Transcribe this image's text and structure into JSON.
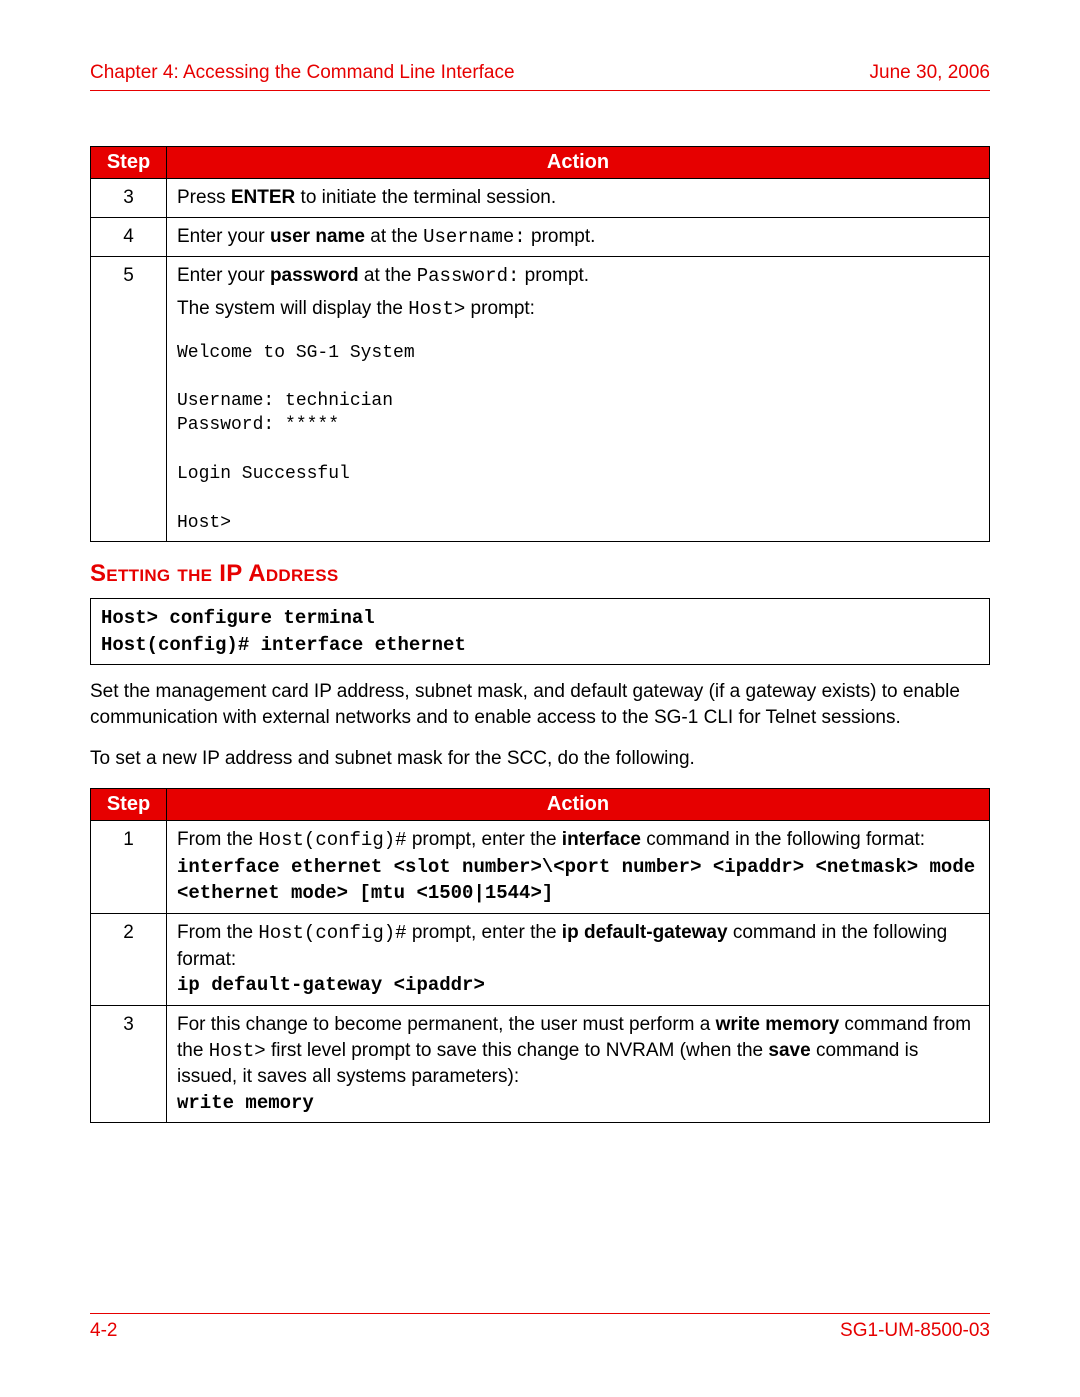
{
  "header": {
    "chapter": "Chapter 4: Accessing the Command Line Interface",
    "date": "June 30, 2006"
  },
  "table1": {
    "head_step": "Step",
    "head_action": "Action",
    "rows": {
      "r3": {
        "num": "3",
        "t1": "Press ",
        "b1": "ENTER",
        "t2": " to initiate the terminal session."
      },
      "r4": {
        "num": "4",
        "t1": "Enter your ",
        "b1": "user name",
        "t2": " at the ",
        "m1": "Username:",
        "t3": " prompt."
      },
      "r5": {
        "num": "5",
        "t1": "Enter your ",
        "b1": "password",
        "t2": " at the ",
        "m1": "Password:",
        "t3": " prompt.",
        "t4": "The system will display the ",
        "m2": "Host>",
        "t5": " prompt:",
        "term1": "Welcome to SG-1 System",
        "term2": "Username: technician",
        "term3": "Password: *****",
        "term4": "Login Successful",
        "term5": "Host>"
      }
    }
  },
  "section_title": "Setting the IP Address",
  "cmdbox": {
    "l1": "Host> configure terminal",
    "l2": "Host(config)# interface ethernet"
  },
  "para1": "Set the management card IP address, subnet mask, and default gateway (if a gateway exists) to enable communication with external networks and to enable access to the SG-1 CLI for Telnet sessions.",
  "para2": "To set a new IP address and subnet mask for the SCC, do the following.",
  "table2": {
    "head_step": "Step",
    "head_action": "Action",
    "rows": {
      "r1": {
        "num": "1",
        "t1": "From the ",
        "m1": "Host(config)#",
        "t2": " prompt, enter the ",
        "b1": "interface",
        "t3": " command in the following format:",
        "c1": "interface ethernet <slot number>\\<port number> <ipaddr> <netmask> mode <ethernet mode> [mtu <1500|1544>]"
      },
      "r2": {
        "num": "2",
        "t1": "From the ",
        "m1": "Host(config)#",
        "t2": " prompt, enter the ",
        "b1": "ip default-gateway",
        "t3": " command in the following format:",
        "c1": "ip default-gateway <ipaddr>"
      },
      "r3": {
        "num": "3",
        "t1": "For this change to become permanent, the user must perform a ",
        "b1": "write memory",
        "t2": " command from the ",
        "m1": "Host>",
        "t3": " first level prompt to save this change to NVRAM (when the ",
        "b2": "save",
        "t4": " command is issued, it saves all systems parameters):",
        "c1": "write memory"
      }
    }
  },
  "footer": {
    "page": "4-2",
    "docid": "SG1-UM-8500-03"
  }
}
